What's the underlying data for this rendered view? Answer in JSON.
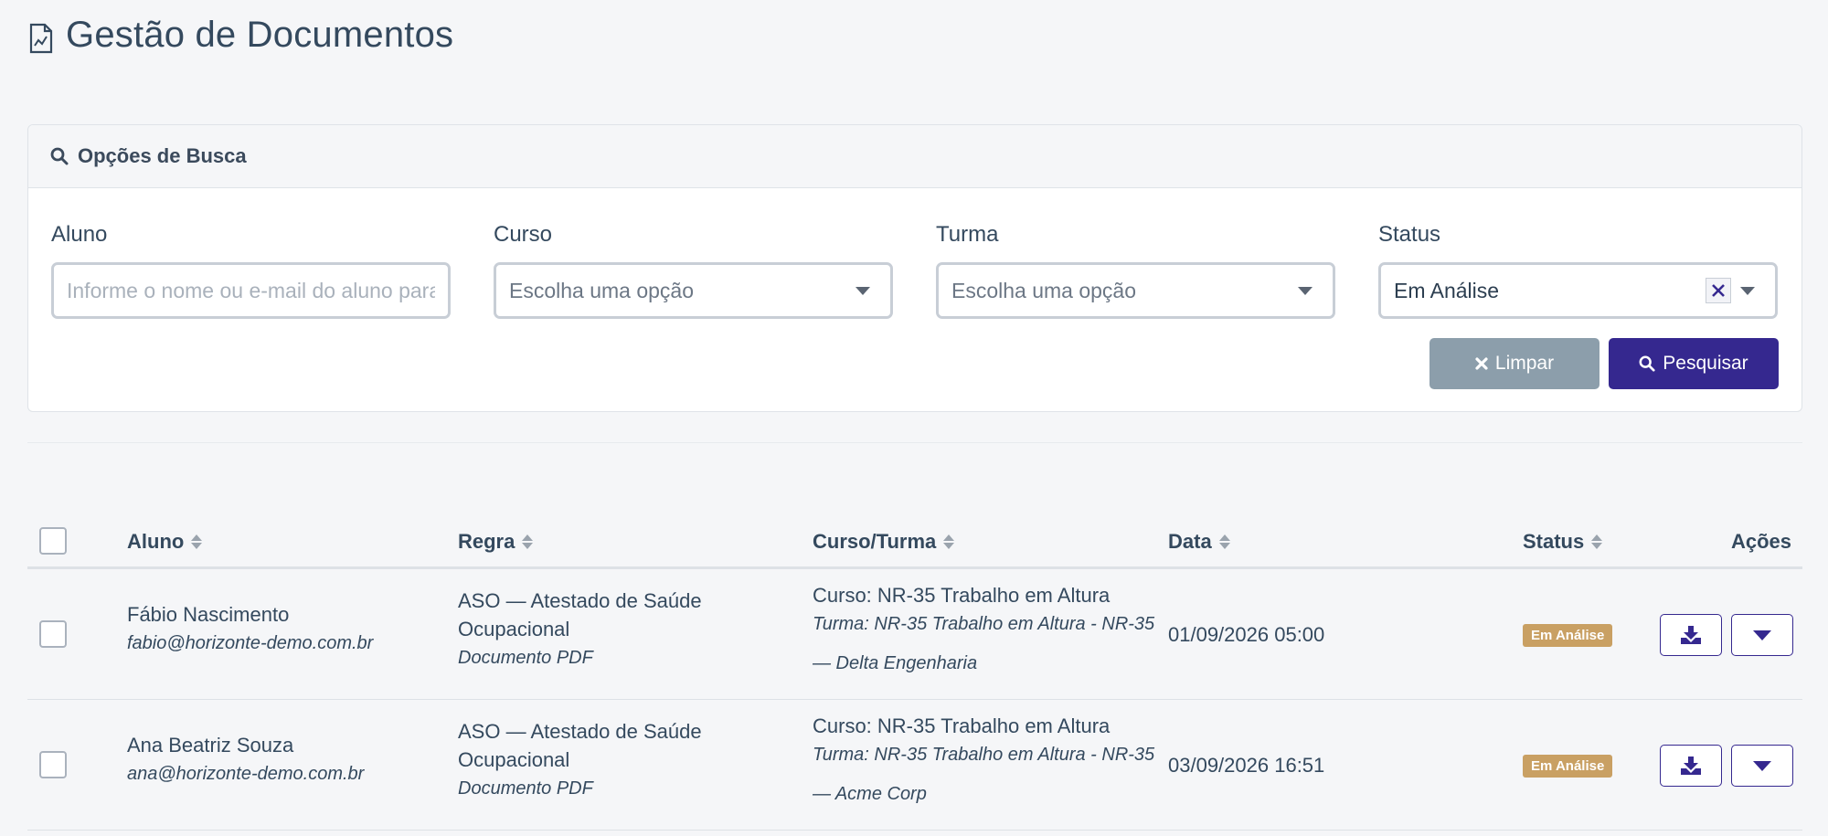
{
  "page": {
    "title": "Gestão de Documentos"
  },
  "search": {
    "title": "Opções de Busca",
    "filters": {
      "aluno": {
        "label": "Aluno",
        "placeholder": "Informe o nome ou e-mail do aluno para pesquisar"
      },
      "curso": {
        "label": "Curso",
        "placeholder": "Escolha uma opção"
      },
      "turma": {
        "label": "Turma",
        "placeholder": "Escolha uma opção"
      },
      "status": {
        "label": "Status",
        "value": "Em Análise"
      }
    },
    "buttons": {
      "clear": "Limpar",
      "search": "Pesquisar"
    }
  },
  "table": {
    "columns": {
      "aluno": "Aluno",
      "regra": "Regra",
      "curso_turma": "Curso/Turma",
      "data": "Data",
      "status": "Status",
      "acoes": "Ações"
    },
    "rows": [
      {
        "name": "Fábio Nascimento",
        "email": "fabio@horizonte-demo.com.br",
        "rule_line1": "ASO — Atestado de Saúde",
        "rule_line2": "Ocupacional",
        "rule_type": "Documento PDF",
        "curso": "Curso: NR-35 Trabalho em Altura",
        "turma_line1": "Turma: NR-35 Trabalho em Altura - NR-35",
        "turma_line2": "— Delta Engenharia",
        "date": "01/09/2026 05:00",
        "status": "Em Análise"
      },
      {
        "name": "Ana Beatriz Souza",
        "email": "ana@horizonte-demo.com.br",
        "rule_line1": "ASO — Atestado de Saúde",
        "rule_line2": "Ocupacional",
        "rule_type": "Documento PDF",
        "curso": "Curso: NR-35 Trabalho em Altura",
        "turma_line1": "Turma: NR-35 Trabalho em Altura - NR-35",
        "turma_line2": "— Acme Corp",
        "date": "03/09/2026 16:51",
        "status": "Em Análise"
      }
    ]
  },
  "colors": {
    "primary": "#35288f",
    "clear_button": "#8c9eab",
    "badge": "#c9a063"
  }
}
